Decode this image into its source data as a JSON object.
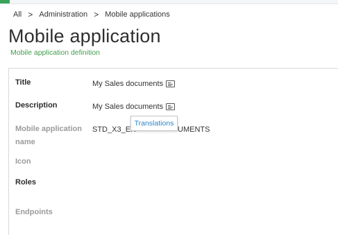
{
  "breadcrumb": {
    "items": [
      "All",
      "Administration",
      "Mobile applications"
    ],
    "separator": ">"
  },
  "page": {
    "title": "Mobile application",
    "subtitle": "Mobile application definition"
  },
  "fields": {
    "title": {
      "label": "Title",
      "value": "My Sales documents"
    },
    "description": {
      "label": "Description",
      "value": "My Sales documents"
    },
    "app_name": {
      "label_line1": "Mobile application",
      "label_line2": "name",
      "value_left": "STD_X3_ER",
      "value_right": "UMENTS"
    },
    "icon": {
      "label": "Icon"
    },
    "roles": {
      "label": "Roles"
    },
    "endpoints": {
      "label": "Endpoints"
    }
  },
  "tooltip": {
    "label": "Translations"
  },
  "colors": {
    "accent": "#3aa35a",
    "subtitle": "#3f9e4a",
    "link": "#2a86c9"
  },
  "icons": {
    "translation": "translation-icon"
  }
}
